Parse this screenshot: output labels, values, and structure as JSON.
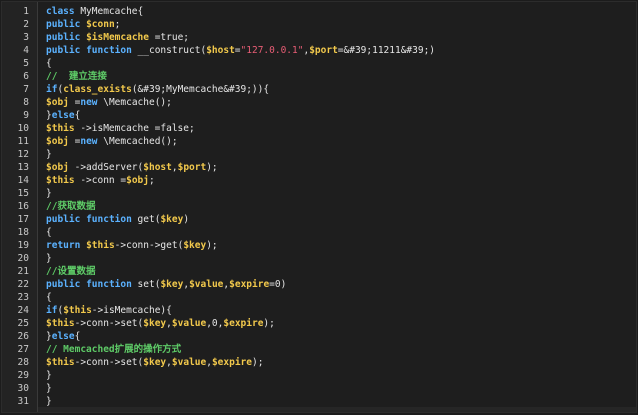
{
  "colors": {
    "background": "#1e1e1e",
    "gutter": "#232323",
    "keyword": "#5bb2ff",
    "variable": "#f2c94c",
    "string": "#e85d75",
    "comment": "#5ecb67",
    "plain": "#e6e6e6",
    "line_number": "#c9c9c9"
  },
  "lines": [
    {
      "n": "1",
      "tokens": [
        {
          "t": "class",
          "c": "kw"
        },
        {
          "t": " MyMemcache{",
          "c": "pl"
        }
      ]
    },
    {
      "n": "2",
      "tokens": [
        {
          "t": "public",
          "c": "kw"
        },
        {
          "t": " ",
          "c": "pl"
        },
        {
          "t": "$conn",
          "c": "var"
        },
        {
          "t": ";",
          "c": "pl"
        }
      ]
    },
    {
      "n": "3",
      "tokens": [
        {
          "t": "public",
          "c": "kw"
        },
        {
          "t": " ",
          "c": "pl"
        },
        {
          "t": "$isMemcache",
          "c": "var"
        },
        {
          "t": " =true;",
          "c": "pl"
        }
      ]
    },
    {
      "n": "4",
      "tokens": [
        {
          "t": "public",
          "c": "kw"
        },
        {
          "t": " ",
          "c": "pl"
        },
        {
          "t": "function",
          "c": "kw"
        },
        {
          "t": " __construct(",
          "c": "pl"
        },
        {
          "t": "$host",
          "c": "var"
        },
        {
          "t": "=",
          "c": "pl"
        },
        {
          "t": "\"127.0.0.1\"",
          "c": "str"
        },
        {
          "t": ",",
          "c": "pl"
        },
        {
          "t": "$port",
          "c": "var"
        },
        {
          "t": "=&#39;11211&#39;)",
          "c": "pl"
        }
      ]
    },
    {
      "n": "5",
      "tokens": [
        {
          "t": "{",
          "c": "pl"
        }
      ]
    },
    {
      "n": "6",
      "tokens": [
        {
          "t": "//  建立连接",
          "c": "cm"
        }
      ]
    },
    {
      "n": "7",
      "tokens": [
        {
          "t": "if",
          "c": "kw"
        },
        {
          "t": "(",
          "c": "pl"
        },
        {
          "t": "class_exists",
          "c": "var"
        },
        {
          "t": "(&#39;MyMemcache&#39;)){",
          "c": "pl"
        }
      ]
    },
    {
      "n": "8",
      "tokens": [
        {
          "t": "$obj",
          "c": "var"
        },
        {
          "t": " =",
          "c": "pl"
        },
        {
          "t": "new",
          "c": "kw"
        },
        {
          "t": " \\Memcache();",
          "c": "pl"
        }
      ]
    },
    {
      "n": "9",
      "tokens": [
        {
          "t": "}",
          "c": "pl"
        },
        {
          "t": "else",
          "c": "kw"
        },
        {
          "t": "{",
          "c": "pl"
        }
      ]
    },
    {
      "n": "10",
      "tokens": [
        {
          "t": "$this",
          "c": "var"
        },
        {
          "t": " ->isMemcache =false;",
          "c": "pl"
        }
      ]
    },
    {
      "n": "11",
      "tokens": [
        {
          "t": "$obj",
          "c": "var"
        },
        {
          "t": " =",
          "c": "pl"
        },
        {
          "t": "new",
          "c": "kw"
        },
        {
          "t": " \\Memcached();",
          "c": "pl"
        }
      ]
    },
    {
      "n": "12",
      "tokens": [
        {
          "t": "}",
          "c": "pl"
        }
      ]
    },
    {
      "n": "13",
      "tokens": [
        {
          "t": "$obj",
          "c": "var"
        },
        {
          "t": " ->addServer(",
          "c": "pl"
        },
        {
          "t": "$host",
          "c": "var"
        },
        {
          "t": ",",
          "c": "pl"
        },
        {
          "t": "$port",
          "c": "var"
        },
        {
          "t": ");",
          "c": "pl"
        }
      ]
    },
    {
      "n": "14",
      "tokens": [
        {
          "t": "$this",
          "c": "var"
        },
        {
          "t": " ->conn =",
          "c": "pl"
        },
        {
          "t": "$obj",
          "c": "var"
        },
        {
          "t": ";",
          "c": "pl"
        }
      ]
    },
    {
      "n": "15",
      "tokens": [
        {
          "t": "}",
          "c": "pl"
        }
      ]
    },
    {
      "n": "16",
      "tokens": [
        {
          "t": "//获取数据",
          "c": "cm"
        }
      ]
    },
    {
      "n": "17",
      "tokens": [
        {
          "t": "public",
          "c": "kw"
        },
        {
          "t": " ",
          "c": "pl"
        },
        {
          "t": "function",
          "c": "kw"
        },
        {
          "t": " get(",
          "c": "pl"
        },
        {
          "t": "$key",
          "c": "var"
        },
        {
          "t": ")",
          "c": "pl"
        }
      ]
    },
    {
      "n": "18",
      "tokens": [
        {
          "t": "{",
          "c": "pl"
        }
      ]
    },
    {
      "n": "19",
      "tokens": [
        {
          "t": "return",
          "c": "kw"
        },
        {
          "t": " ",
          "c": "pl"
        },
        {
          "t": "$this",
          "c": "var"
        },
        {
          "t": "->conn->get(",
          "c": "pl"
        },
        {
          "t": "$key",
          "c": "var"
        },
        {
          "t": ");",
          "c": "pl"
        }
      ]
    },
    {
      "n": "20",
      "tokens": [
        {
          "t": "}",
          "c": "pl"
        }
      ]
    },
    {
      "n": "21",
      "tokens": [
        {
          "t": "//设置数据",
          "c": "cm"
        }
      ]
    },
    {
      "n": "22",
      "tokens": [
        {
          "t": "public",
          "c": "kw"
        },
        {
          "t": " ",
          "c": "pl"
        },
        {
          "t": "function",
          "c": "kw"
        },
        {
          "t": " set(",
          "c": "pl"
        },
        {
          "t": "$key",
          "c": "var"
        },
        {
          "t": ",",
          "c": "pl"
        },
        {
          "t": "$value",
          "c": "var"
        },
        {
          "t": ",",
          "c": "pl"
        },
        {
          "t": "$expire",
          "c": "var"
        },
        {
          "t": "=0)",
          "c": "pl"
        }
      ]
    },
    {
      "n": "23",
      "tokens": [
        {
          "t": "{",
          "c": "pl"
        }
      ]
    },
    {
      "n": "24",
      "tokens": [
        {
          "t": "if",
          "c": "kw"
        },
        {
          "t": "(",
          "c": "pl"
        },
        {
          "t": "$this",
          "c": "var"
        },
        {
          "t": "->isMemcache){",
          "c": "pl"
        }
      ]
    },
    {
      "n": "25",
      "tokens": [
        {
          "t": "$this",
          "c": "var"
        },
        {
          "t": "->conn->set(",
          "c": "pl"
        },
        {
          "t": "$key",
          "c": "var"
        },
        {
          "t": ",",
          "c": "pl"
        },
        {
          "t": "$value",
          "c": "var"
        },
        {
          "t": ",0,",
          "c": "pl"
        },
        {
          "t": "$expire",
          "c": "var"
        },
        {
          "t": ");",
          "c": "pl"
        }
      ]
    },
    {
      "n": "26",
      "tokens": [
        {
          "t": "}",
          "c": "pl"
        },
        {
          "t": "else",
          "c": "kw"
        },
        {
          "t": "{",
          "c": "pl"
        }
      ]
    },
    {
      "n": "27",
      "tokens": [
        {
          "t": "// Memcached扩展的操作方式",
          "c": "cm"
        }
      ]
    },
    {
      "n": "28",
      "tokens": [
        {
          "t": "$this",
          "c": "var"
        },
        {
          "t": "->conn->set(",
          "c": "pl"
        },
        {
          "t": "$key",
          "c": "var"
        },
        {
          "t": ",",
          "c": "pl"
        },
        {
          "t": "$value",
          "c": "var"
        },
        {
          "t": ",",
          "c": "pl"
        },
        {
          "t": "$expire",
          "c": "var"
        },
        {
          "t": ");",
          "c": "pl"
        }
      ]
    },
    {
      "n": "29",
      "tokens": [
        {
          "t": "}",
          "c": "pl"
        }
      ]
    },
    {
      "n": "30",
      "tokens": [
        {
          "t": "}",
          "c": "pl"
        }
      ]
    },
    {
      "n": "31",
      "tokens": [
        {
          "t": "}",
          "c": "pl"
        }
      ]
    }
  ]
}
